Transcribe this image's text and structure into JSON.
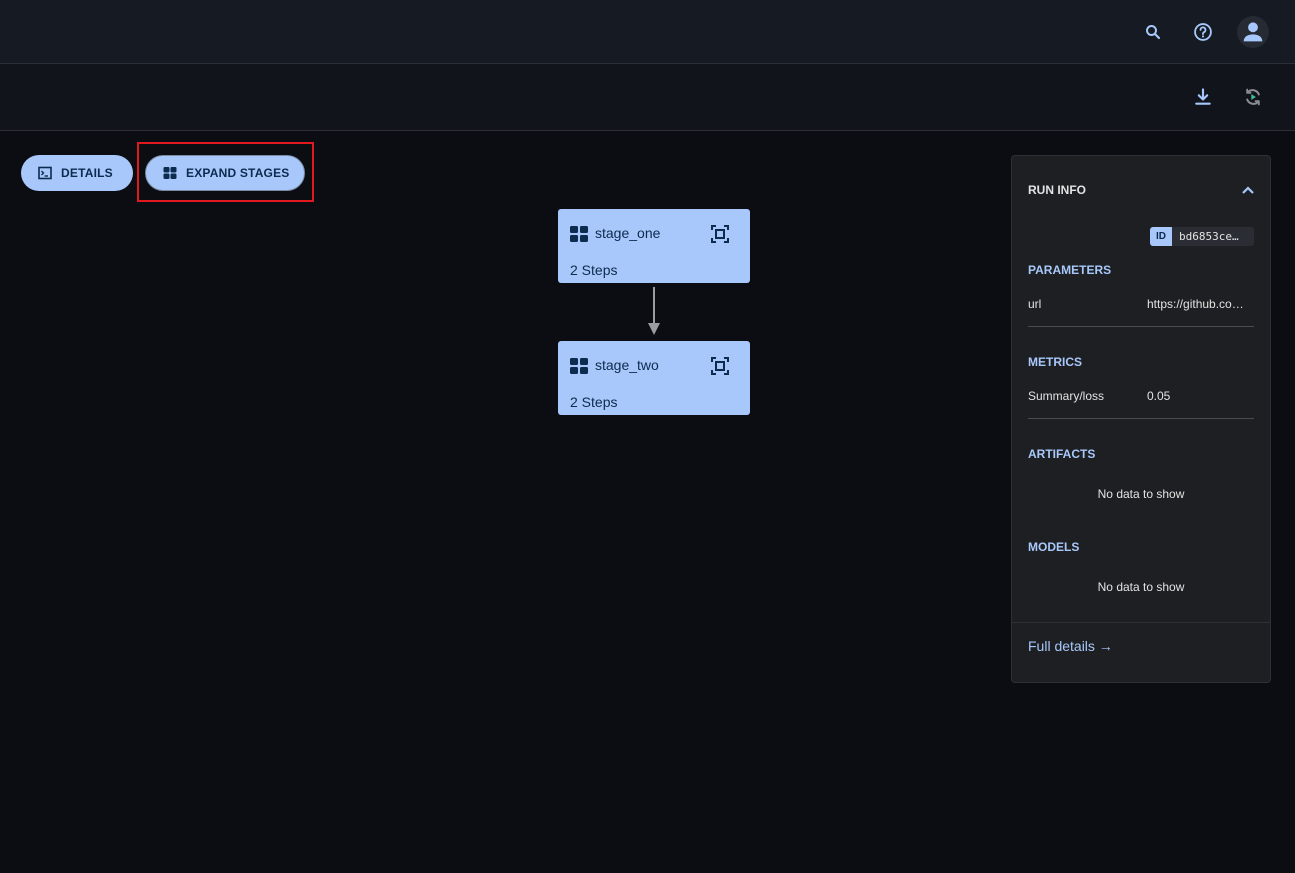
{
  "header": {
    "icons": [
      "search-icon",
      "help-icon",
      "account-icon"
    ]
  },
  "toolbar": {
    "icons": [
      "download-icon",
      "rerun-icon"
    ]
  },
  "actions": {
    "details_label": "DETAILS",
    "expand_label": "EXPAND STAGES"
  },
  "graph": {
    "stages": [
      {
        "name": "stage_one",
        "steps": "2 Steps"
      },
      {
        "name": "stage_two",
        "steps": "2 Steps"
      }
    ]
  },
  "run_info": {
    "title": "RUN INFO",
    "id_tag": "ID",
    "id_value": "bd6853ce…",
    "parameters_label": "PARAMETERS",
    "parameters": [
      {
        "key": "url",
        "value": "https://github.co…"
      }
    ],
    "metrics_label": "METRICS",
    "metrics": [
      {
        "key": "Summary/loss",
        "value": "0.05"
      }
    ],
    "artifacts_label": "ARTIFACTS",
    "artifacts_empty": "No data to show",
    "models_label": "MODELS",
    "models_empty": "No data to show",
    "full_details": "Full details →"
  },
  "colors": {
    "accent": "#a8c8fb",
    "accent_text": "#0c2b4e",
    "highlight": "#e0191f",
    "rerun_play": "#3fbf9a"
  }
}
